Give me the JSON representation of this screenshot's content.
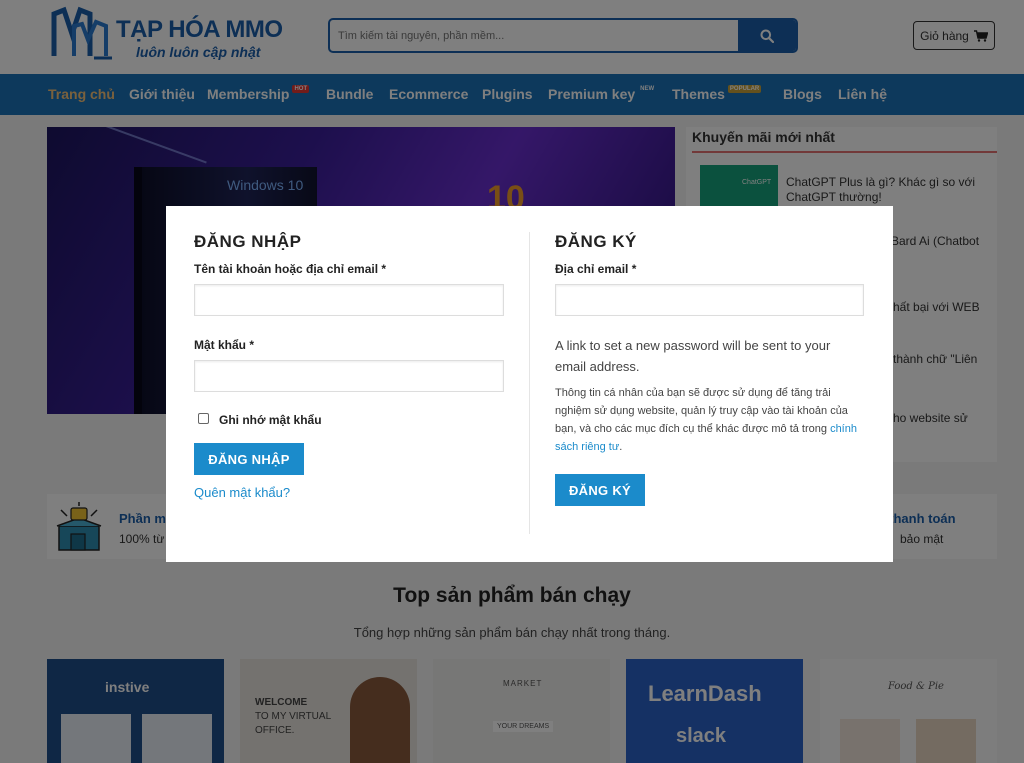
{
  "header": {
    "logo_title": "TẠP HÓA MMO",
    "logo_subtitle": "luôn luôn cập nhật",
    "search_placeholder": "Tìm kiếm tài nguyên, phần mềm...",
    "cart_label": "Giỏ hàng"
  },
  "nav": {
    "items": [
      {
        "label": "Trang chủ"
      },
      {
        "label": "Giới thiệu"
      },
      {
        "label": "Membership",
        "badge": "HOT"
      },
      {
        "label": "Bundle"
      },
      {
        "label": "Ecommerce"
      },
      {
        "label": "Plugins"
      },
      {
        "label": "Premium key",
        "badge": "NEW"
      },
      {
        "label": "Themes",
        "badge": "POPULAR"
      },
      {
        "label": "Blogs"
      },
      {
        "label": "Liên hệ"
      }
    ]
  },
  "banner": {
    "product_text": "Windows 10",
    "number": "10"
  },
  "promotions": {
    "title": "Khuyến mãi mới nhất",
    "thumb_text": "ChatGPT",
    "items": [
      {
        "line1": "ChatGPT Plus là gì? Khác gì so với",
        "line2": "ChatGPT thường!"
      },
      {
        "line1": "Bard Ai (Chatbot",
        "line2": ""
      },
      {
        "line1": "hất bại với WEB",
        "line2": ""
      },
      {
        "line1": "thành chữ \"Liên",
        "line2": ""
      },
      {
        "line1": "ho website sử",
        "line2": ""
      }
    ]
  },
  "features": {
    "left_title": "Phần m",
    "left_text": "100% từ",
    "right_title": "g, thanh toán",
    "right_text": "bảo mật"
  },
  "section": {
    "title": "Top sản phẩm bán chạy",
    "subtitle": "Tổng hợp những sản phẩm bán chạy nhất trong tháng."
  },
  "cards": {
    "instive": "instive",
    "welcome_line1": "WELCOME",
    "welcome_line2": "TO MY VIRTUAL",
    "welcome_line3": "OFFICE.",
    "market": "MARKET",
    "market_banner": "YOUR DREAMS",
    "learndash": "LearnDash",
    "slack": "slack",
    "food": "Food & Pie"
  },
  "login": {
    "heading": "ĐĂNG NHẬP",
    "username_label": "Tên tài khoản hoặc địa chỉ email *",
    "username_value": "",
    "password_label": "Mật khẩu *",
    "password_value": "",
    "remember_label": "Ghi nhớ mật khẩu",
    "remember_checked": false,
    "submit_label": "ĐĂNG NHẬP",
    "forgot_label": "Quên mật khẩu?"
  },
  "register": {
    "heading": "ĐĂNG KÝ",
    "email_label": "Địa chỉ email *",
    "email_value": "",
    "notice": "A link to set a new password will be sent to your email address.",
    "privacy_text": "Thông tin cá nhân của bạn sẽ được sử dụng để tăng trải nghiệm sử dụng website, quản lý truy cập vào tài khoản của bạn, và cho các mục đích cụ thể khác được mô tả trong",
    "privacy_link": "chính sách riêng tư",
    "privacy_end": ".",
    "submit_label": "ĐĂNG KÝ"
  },
  "colors": {
    "brand_blue": "#1a5eab",
    "nav_blue": "#1a73b8",
    "button_blue": "#1b8bcb",
    "nav_active": "#f5c27a",
    "overlay": "rgba(0,0,0,0.5)"
  }
}
